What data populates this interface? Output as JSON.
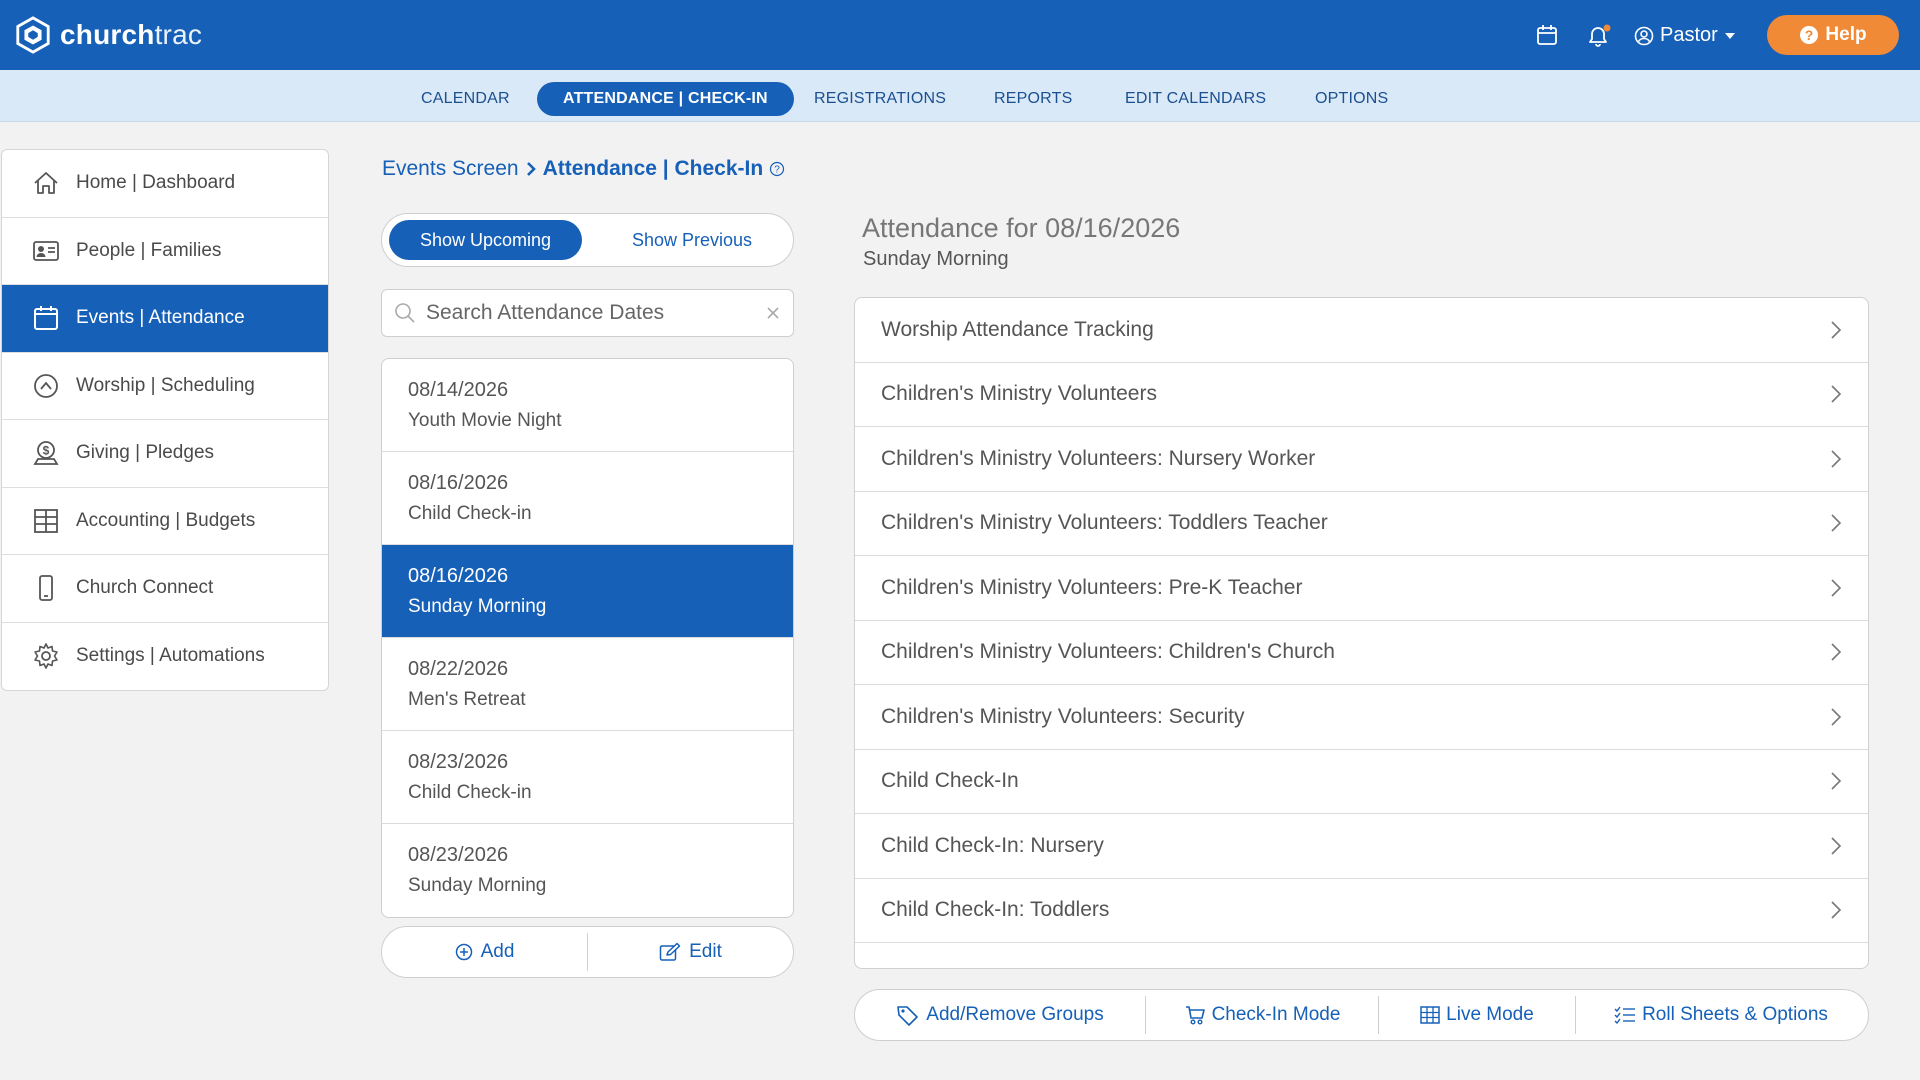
{
  "app": {
    "logo_bold": "church",
    "logo_light": "trac"
  },
  "header": {
    "user_name": "Pastor",
    "help_label": "Help",
    "icons": [
      "calendar-icon",
      "bell-icon",
      "user-circle-icon"
    ],
    "accent": "#1660b8",
    "help_color": "#f08a37",
    "notification_dot_color": "#f08a37"
  },
  "subnav": {
    "items": [
      {
        "label": "CALENDAR",
        "active": false
      },
      {
        "label": "ATTENDANCE | CHECK-IN",
        "active": true
      },
      {
        "label": "REGISTRATIONS",
        "active": false
      },
      {
        "label": "REPORTS",
        "active": false
      },
      {
        "label": "EDIT CALENDARS",
        "active": false
      },
      {
        "label": "OPTIONS",
        "active": false
      }
    ]
  },
  "sidebar": {
    "items": [
      {
        "label": "Home | Dashboard",
        "icon": "home-icon",
        "active": false
      },
      {
        "label": "People | Families",
        "icon": "id-card-icon",
        "active": false
      },
      {
        "label": "Events | Attendance",
        "icon": "calendar-icon",
        "active": true
      },
      {
        "label": "Worship | Scheduling",
        "icon": "chevron-circle-icon",
        "active": false
      },
      {
        "label": "Giving | Pledges",
        "icon": "donation-icon",
        "active": false
      },
      {
        "label": "Accounting | Budgets",
        "icon": "ledger-grid-icon",
        "active": false
      },
      {
        "label": "Church Connect",
        "icon": "mobile-phone-icon",
        "active": false
      },
      {
        "label": "Settings | Automations",
        "icon": "gear-icon",
        "active": false
      }
    ]
  },
  "breadcrumb": {
    "parent": "Events Screen",
    "current": "Attendance | Check-In"
  },
  "toggle": {
    "upcoming_label": "Show Upcoming",
    "previous_label": "Show Previous",
    "selected": "upcoming"
  },
  "search": {
    "placeholder": "Search Attendance Dates",
    "value": ""
  },
  "dates": [
    {
      "date": "08/14/2026",
      "name": "Youth Movie Night",
      "selected": false
    },
    {
      "date": "08/16/2026",
      "name": "Child Check-in",
      "selected": false
    },
    {
      "date": "08/16/2026",
      "name": "Sunday Morning",
      "selected": true
    },
    {
      "date": "08/22/2026",
      "name": "Men's Retreat",
      "selected": false
    },
    {
      "date": "08/23/2026",
      "name": "Child Check-in",
      "selected": false
    },
    {
      "date": "08/23/2026",
      "name": "Sunday Morning",
      "selected": false
    }
  ],
  "date_actions": {
    "add_label": "Add",
    "edit_label": "Edit"
  },
  "attendance": {
    "title": "Attendance for 08/16/2026",
    "subtitle": "Sunday Morning",
    "groups": [
      "Worship Attendance Tracking",
      "Children's Ministry Volunteers",
      "Children's Ministry Volunteers: Nursery Worker",
      "Children's Ministry Volunteers: Toddlers Teacher",
      "Children's Ministry Volunteers: Pre-K Teacher",
      "Children's Ministry Volunteers: Children's Church",
      "Children's Ministry Volunteers: Security",
      "Child Check-In",
      "Child Check-In: Nursery",
      "Child Check-In: Toddlers"
    ]
  },
  "actions": {
    "add_remove_groups": "Add/Remove Groups",
    "check_in_mode": "Check-In Mode",
    "live_mode": "Live Mode",
    "roll_sheets": "Roll Sheets & Options"
  }
}
